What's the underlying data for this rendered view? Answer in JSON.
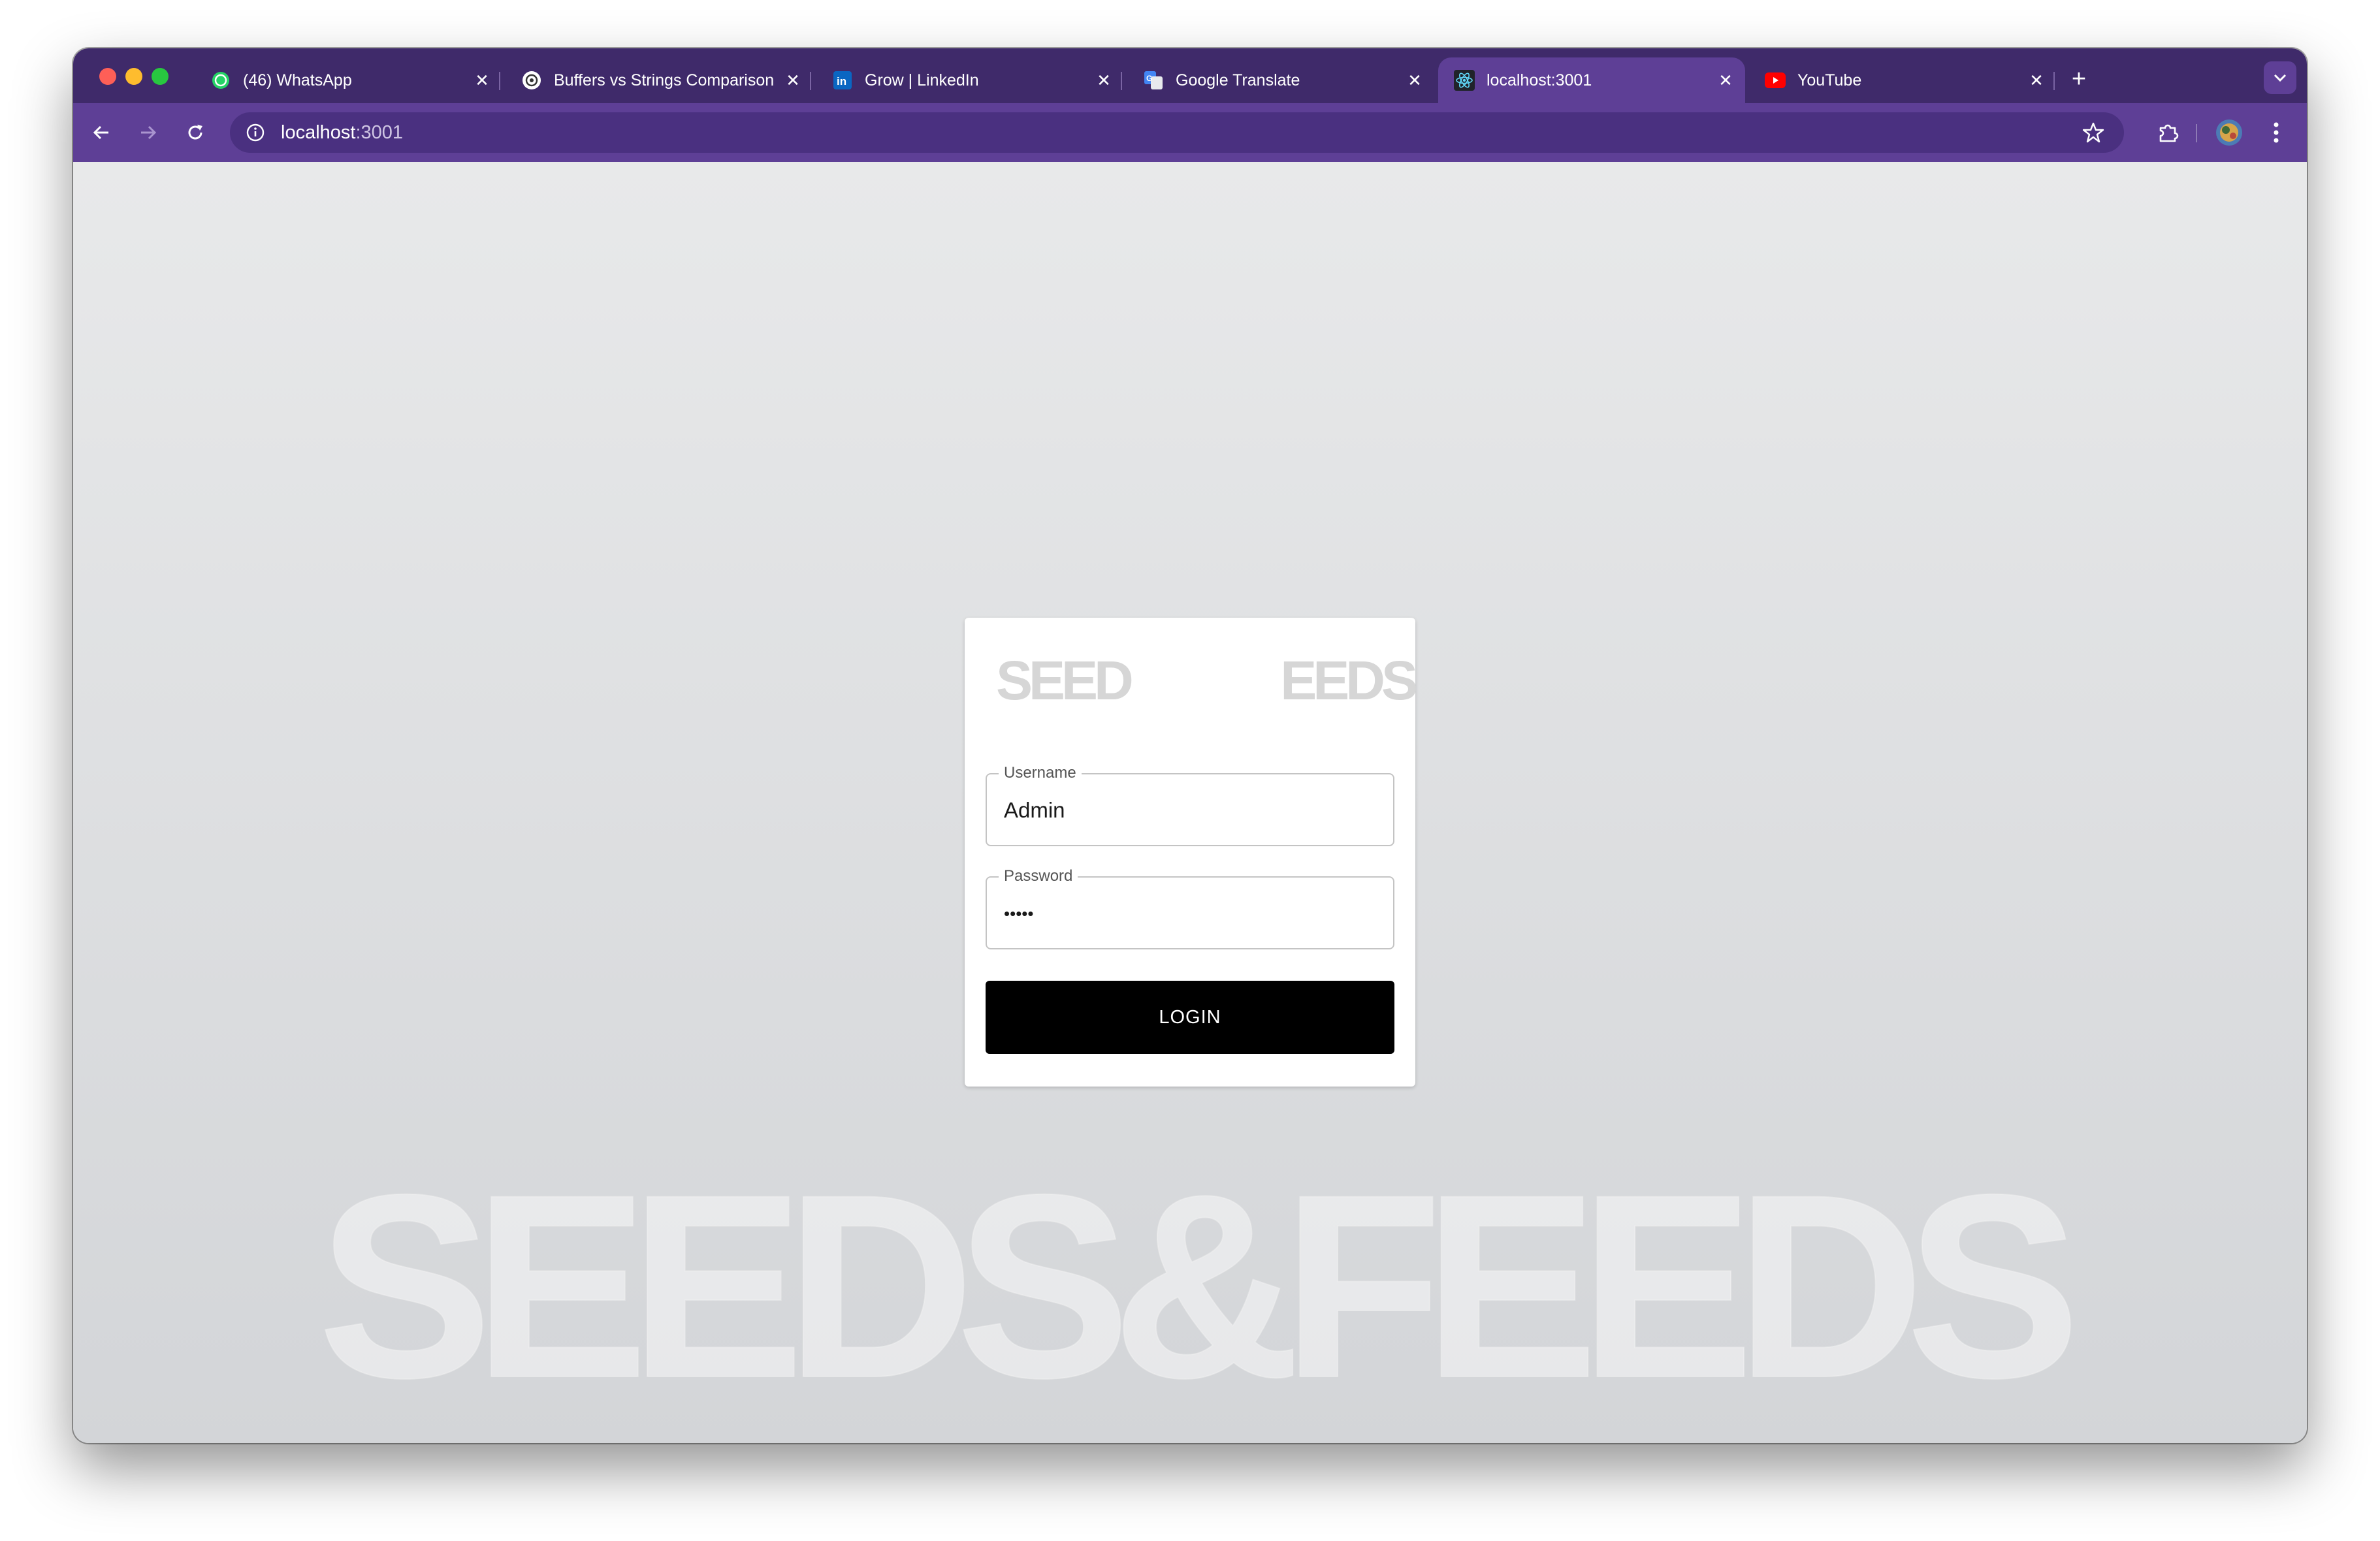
{
  "browser": {
    "tabs": [
      {
        "title": "(46) WhatsApp",
        "icon": "whatsapp-icon",
        "active": false
      },
      {
        "title": "Buffers vs Strings Comparison",
        "icon": "openai-icon",
        "active": false
      },
      {
        "title": "Grow | LinkedIn",
        "icon": "linkedin-icon",
        "active": false
      },
      {
        "title": "Google Translate",
        "icon": "google-translate-icon",
        "active": false
      },
      {
        "title": "localhost:3001",
        "icon": "react-icon",
        "active": true
      },
      {
        "title": "YouTube",
        "icon": "youtube-icon",
        "active": false
      }
    ],
    "close_glyph": "✕",
    "new_tab_glyph": "+",
    "address": {
      "host": "localhost",
      "port": ":3001"
    },
    "colors": {
      "tabstrip": "#3f2a6a",
      "toolbar": "#5e3f96",
      "omnibox": "#4a3080"
    }
  },
  "login": {
    "logo_left": "SEED",
    "logo_right": "EEDS",
    "username_label": "Username",
    "username_value": "Admin",
    "password_label": "Password",
    "password_value": "•••••",
    "button_label": "LOGIN"
  },
  "background": {
    "watermark": "SEEDS&FEEDS"
  }
}
